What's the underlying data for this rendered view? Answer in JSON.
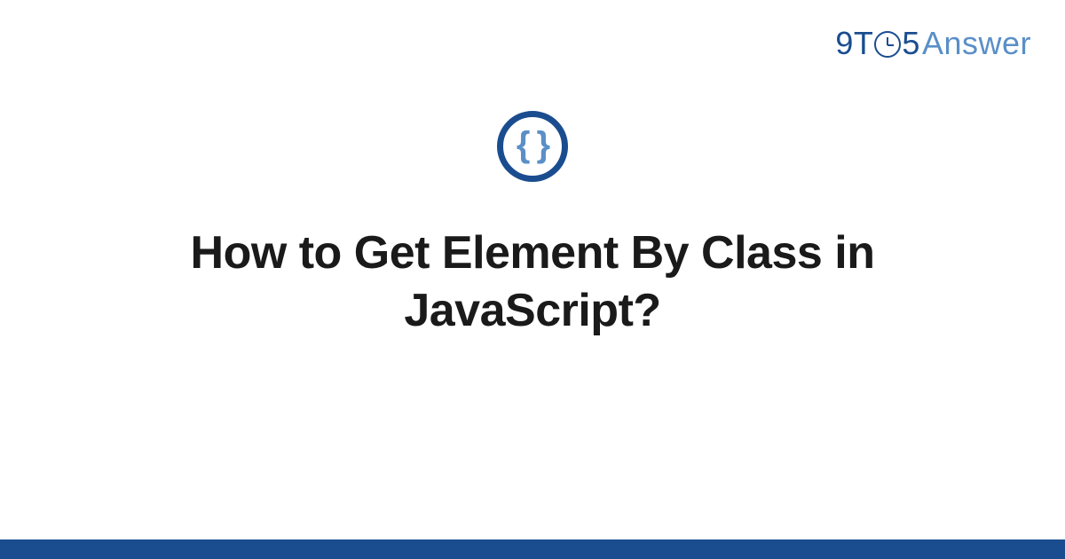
{
  "logo": {
    "part_9t": "9T",
    "part_5": "5",
    "part_answer": "Answer"
  },
  "icon": {
    "name": "code-braces-icon",
    "glyph": "{ }"
  },
  "title": "How to Get Element By Class in JavaScript?",
  "colors": {
    "brand_dark": "#1a4d8f",
    "brand_light": "#5a8fc7",
    "text": "#1a1a1a",
    "background": "#ffffff"
  }
}
